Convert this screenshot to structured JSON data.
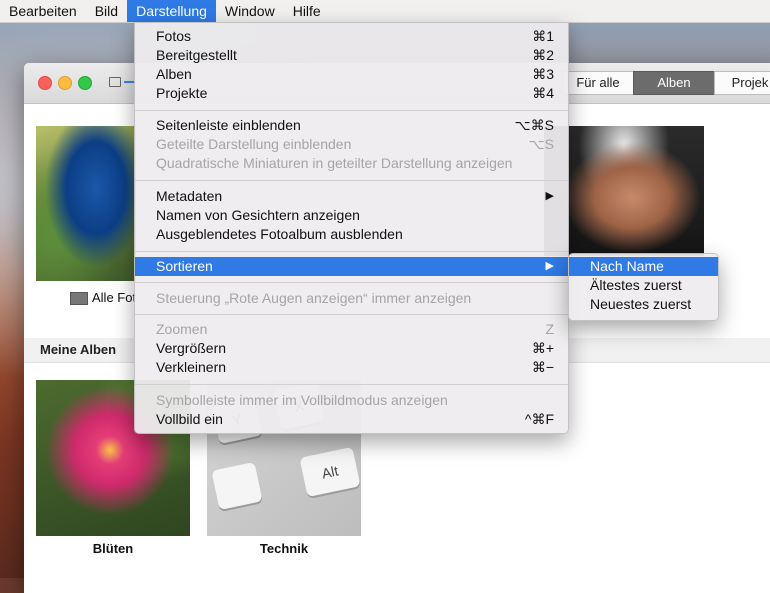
{
  "menubar": {
    "items": [
      "Bearbeiten",
      "Bild",
      "Darstellung",
      "Window",
      "Hilfe"
    ],
    "active_index": 2
  },
  "window": {
    "toolbar_tabs": [
      "Für alle",
      "Alben",
      "Projek"
    ],
    "selected_tab": "Alben",
    "alle_fotos_label": "Alle Fot",
    "section_title": "Meine Alben",
    "albums": [
      {
        "caption": "Blüten"
      },
      {
        "caption": "Technik"
      }
    ],
    "keyboard_keys": [
      "Y",
      "X",
      "Alt"
    ]
  },
  "menu": {
    "items": [
      {
        "label": "Fotos",
        "shortcut": "⌘1",
        "enabled": true
      },
      {
        "label": "Bereitgestellt",
        "shortcut": "⌘2",
        "enabled": true
      },
      {
        "label": "Alben",
        "shortcut": "⌘3",
        "enabled": true
      },
      {
        "label": "Projekte",
        "shortcut": "⌘4",
        "enabled": true
      },
      {
        "label": "Seitenleiste einblenden",
        "shortcut": "⌥⌘S",
        "enabled": true
      },
      {
        "label": "Geteilte Darstellung einblenden",
        "shortcut": "⌥S",
        "enabled": false
      },
      {
        "label": "Quadratische Miniaturen in geteilter Darstellung anzeigen",
        "shortcut": "",
        "enabled": false
      },
      {
        "label": "Metadaten",
        "shortcut": "▶",
        "enabled": true
      },
      {
        "label": "Namen von Gesichtern anzeigen",
        "shortcut": "",
        "enabled": true
      },
      {
        "label": "Ausgeblendetes Fotoalbum ausblenden",
        "shortcut": "",
        "enabled": true
      },
      {
        "label": "Sortieren",
        "shortcut": "▶",
        "enabled": true,
        "highlighted": true
      },
      {
        "label": "Steuerung „Rote Augen anzeigen“ immer anzeigen",
        "shortcut": "",
        "enabled": false
      },
      {
        "label": "Zoomen",
        "shortcut": "Z",
        "enabled": false
      },
      {
        "label": "Vergrößern",
        "shortcut": "⌘+",
        "enabled": true
      },
      {
        "label": "Verkleinern",
        "shortcut": "⌘−",
        "enabled": true
      },
      {
        "label": "Symbolleiste immer im Vollbildmodus anzeigen",
        "shortcut": "",
        "enabled": false
      },
      {
        "label": "Vollbild ein",
        "shortcut": "^⌘F",
        "enabled": true
      }
    ]
  },
  "submenu": {
    "items": [
      {
        "label": "Nach Name",
        "highlighted": true
      },
      {
        "label": "Ältestes zuerst",
        "highlighted": false
      },
      {
        "label": "Neuestes zuerst",
        "highlighted": false
      }
    ]
  },
  "colors": {
    "accent": "#2f7ae5",
    "disabled_text": "#a7a4a6"
  }
}
